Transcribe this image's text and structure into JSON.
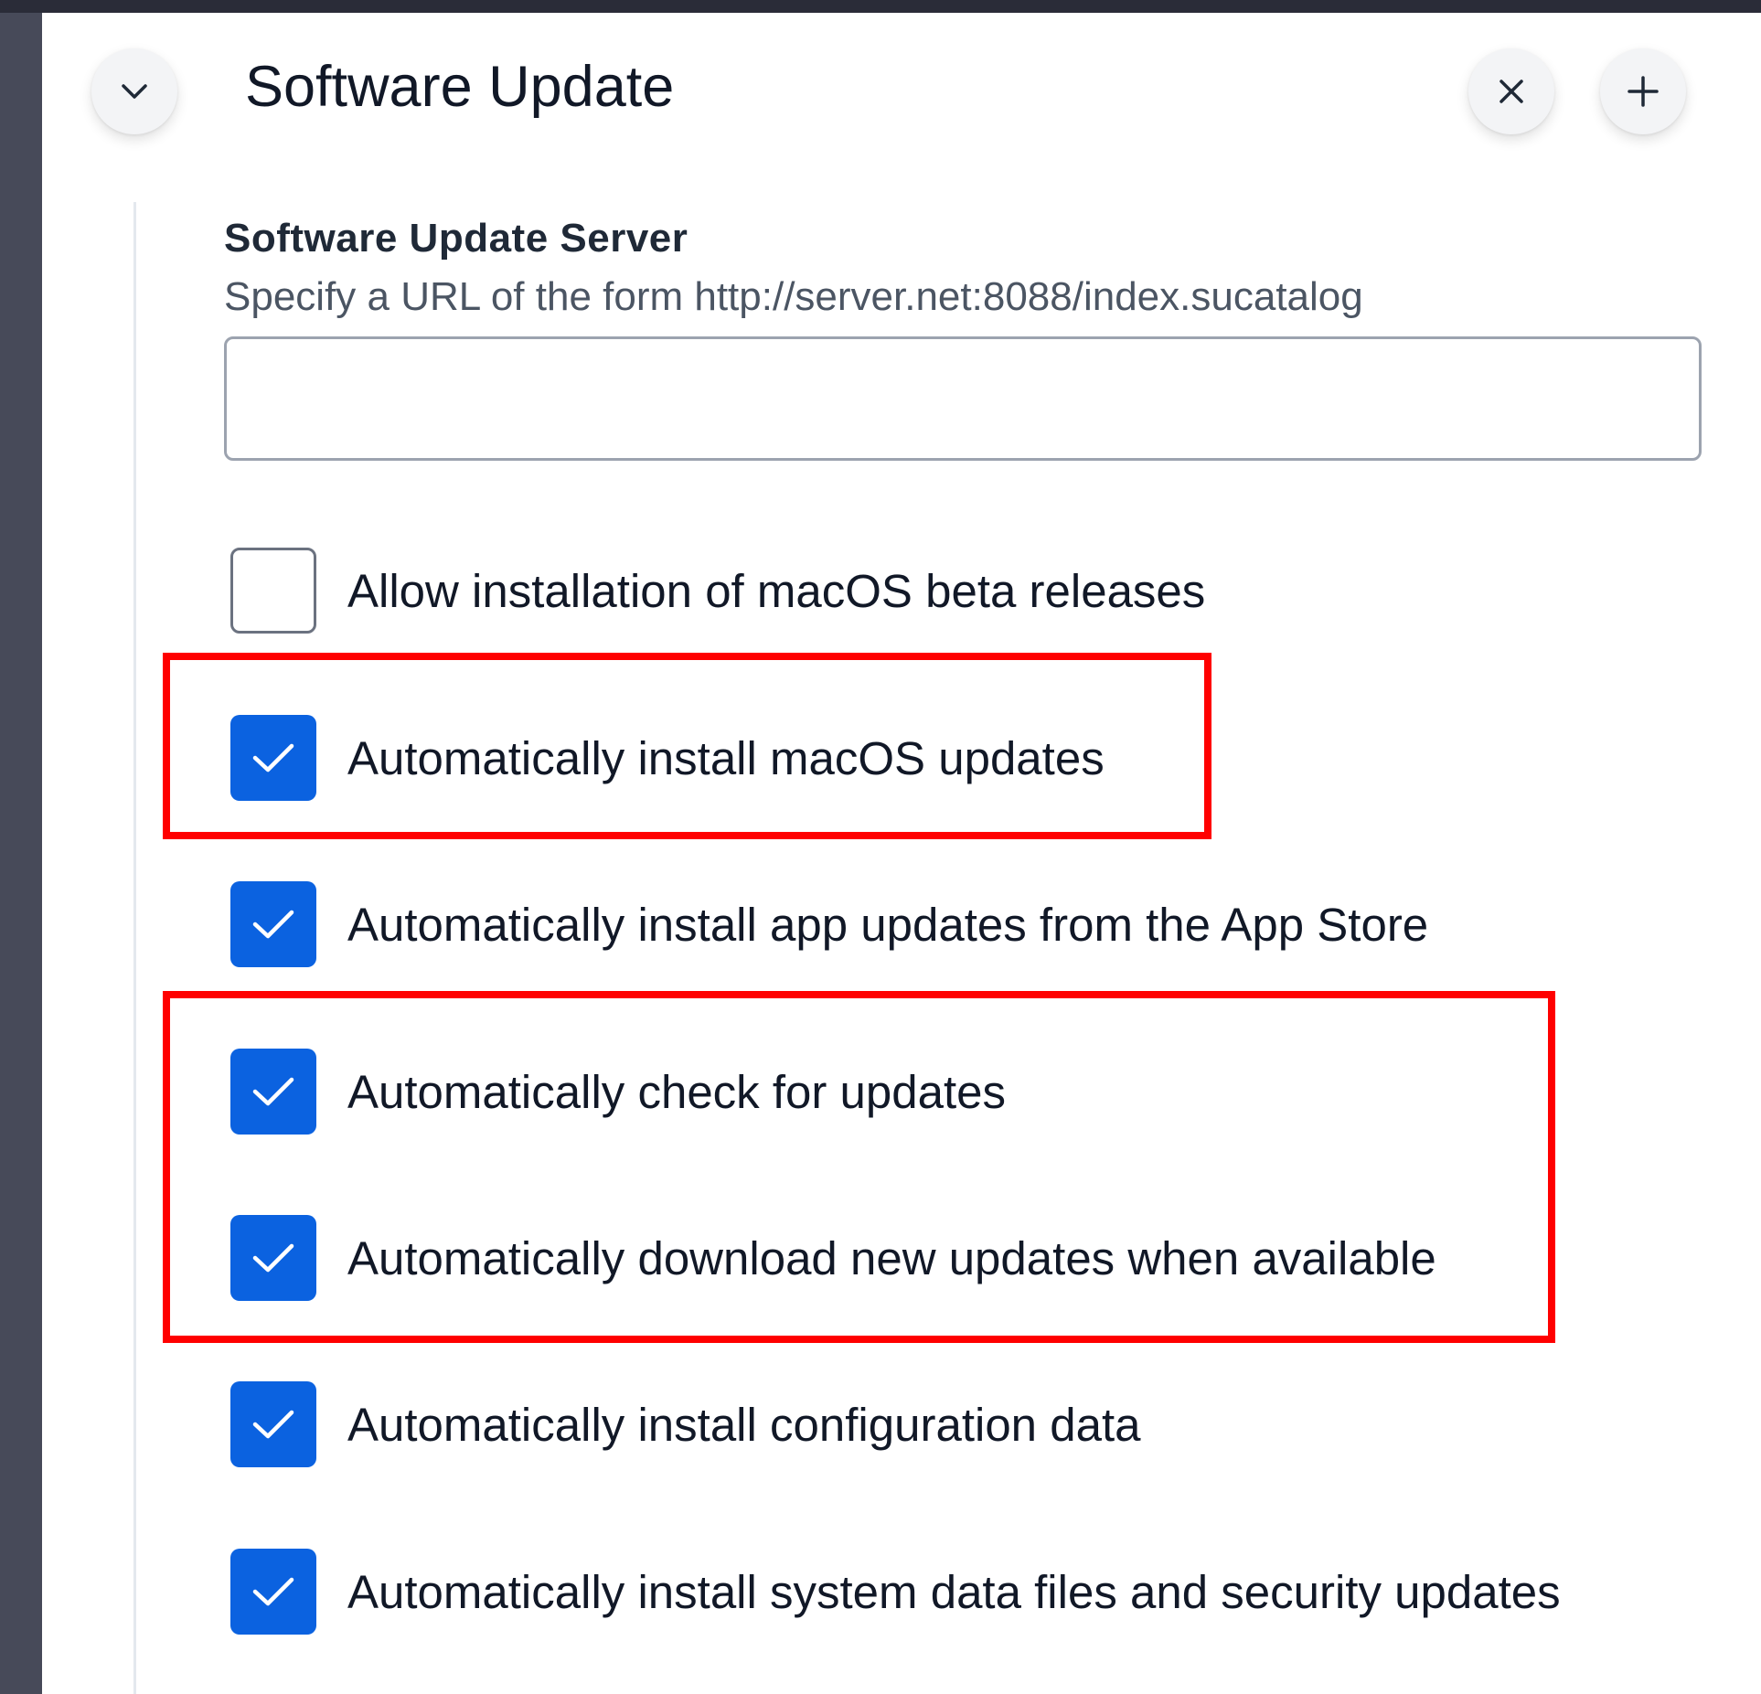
{
  "header": {
    "title": "Software Update",
    "collapse_icon": "chevron-down-icon",
    "remove_icon": "close-icon",
    "add_icon": "plus-icon"
  },
  "server_field": {
    "label": "Software Update Server",
    "help": "Specify a URL of the form http://server.net:8088/index.sucatalog",
    "value": "",
    "placeholder": ""
  },
  "options": [
    {
      "label": "Allow installation of macOS beta releases",
      "checked": false
    },
    {
      "label": "Automatically install macOS updates",
      "checked": true
    },
    {
      "label": "Automatically install app updates from the App Store",
      "checked": true
    },
    {
      "label": "Automatically check for updates",
      "checked": true
    },
    {
      "label": "Automatically download new updates when available",
      "checked": true
    },
    {
      "label": "Automatically install configuration data",
      "checked": true
    },
    {
      "label": "Automatically install system data files and security updates",
      "checked": true
    }
  ],
  "colors": {
    "checkbox_checked": "#0b62e0",
    "highlight_border": "#ff0000",
    "backdrop": "#474a59"
  }
}
